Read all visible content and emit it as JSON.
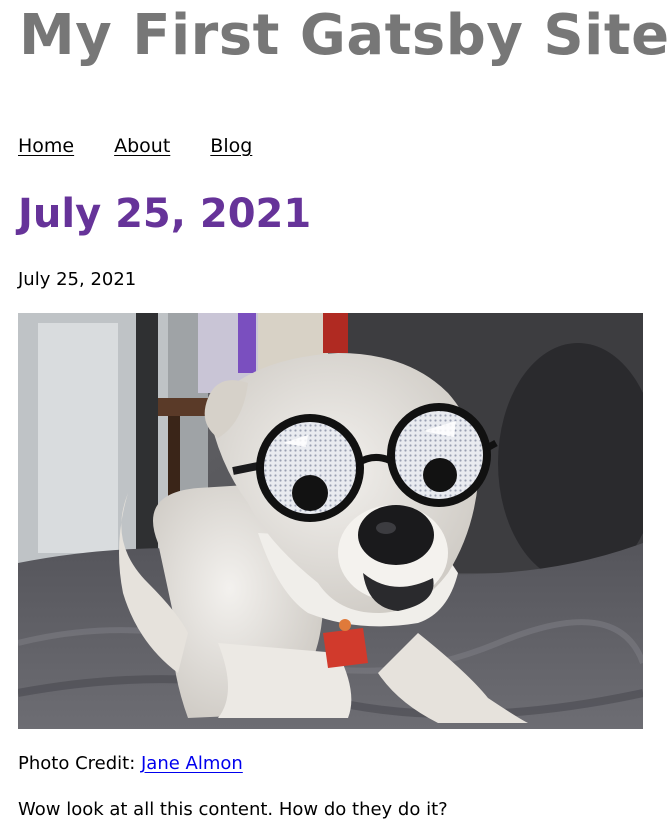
{
  "site": {
    "title": "My First Gatsby Site"
  },
  "nav": {
    "items": [
      {
        "label": "Home"
      },
      {
        "label": "About"
      },
      {
        "label": "Blog"
      }
    ]
  },
  "post": {
    "title": "July 25, 2021",
    "date": "July 25, 2021",
    "image": {
      "icon": "dog-with-googly-glasses-photo"
    },
    "credit_prefix": "Photo Credit: ",
    "credit_name": "Jane Almon",
    "body": "Wow look at all this content. How do they do it?"
  },
  "colors": {
    "site_title": "#777777",
    "post_title": "#663399",
    "link": "#0000ee"
  }
}
